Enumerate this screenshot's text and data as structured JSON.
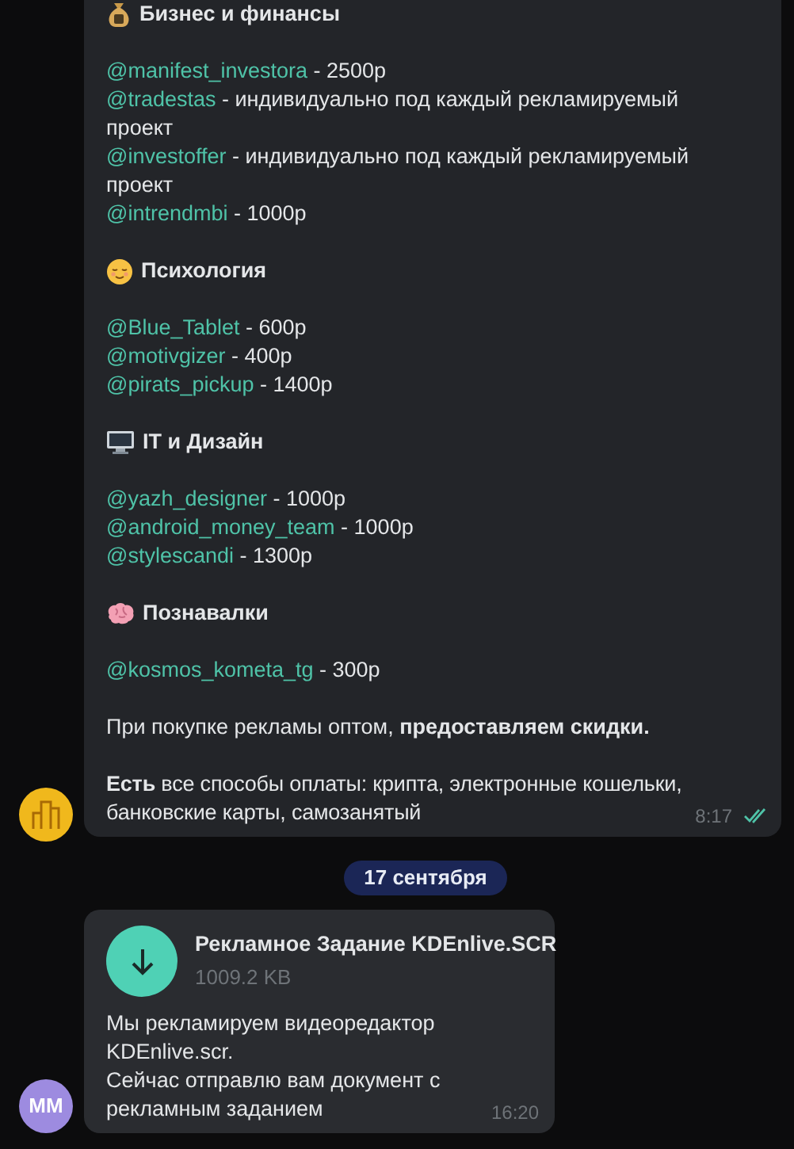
{
  "channel_post": {
    "avatar": {
      "kind": "buildings"
    },
    "sections": [
      {
        "kind": "money",
        "title": "Бизнес и финансы",
        "entries": [
          {
            "handle": "@manifest_investora",
            "text": " - 2500р"
          },
          {
            "handle": "@tradestas",
            "text": " - индивидуально под каждый рекламируемый проект"
          },
          {
            "handle": "@investoffer",
            "text": " - индивидуально под каждый рекламируемый проект"
          },
          {
            "handle": "@intrendmbi",
            "text": " - 1000р"
          }
        ]
      },
      {
        "kind": "relieved",
        "title": "Психология",
        "entries": [
          {
            "handle": "@Blue_Tablet",
            "text": " - 600р"
          },
          {
            "handle": "@motivgizer",
            "text": " - 400р"
          },
          {
            "handle": "@pirats_pickup",
            "text": " - 1400р"
          }
        ]
      },
      {
        "kind": "computer",
        "title": "IT и Дизайн",
        "entries": [
          {
            "handle": "@yazh_designer",
            "text": " - 1000р"
          },
          {
            "handle": "@android_money_team",
            "text": " - 1000р"
          },
          {
            "handle": "@stylescandi",
            "text": " - 1300р"
          }
        ]
      },
      {
        "kind": "brain",
        "title": "Познавалки",
        "entries": [
          {
            "handle": "@kosmos_kometa_tg",
            "text": " - 300р"
          }
        ]
      }
    ],
    "notes": [
      "При покупке рекламы оптом, **предоставляем скидки.**",
      "**Есть** все способы оплаты: крипта, электронные кошельки, банковские карты, самозанятый"
    ],
    "time": "8:17",
    "read": true
  },
  "date_separator": "17 сентября",
  "file_message": {
    "avatar": {
      "initials": "MM"
    },
    "file_name": "Рекламное Задание KDEnlive.SCR",
    "file_size": "1009.2 KB",
    "paragraphs": [
      "Мы рекламируем видеоредактор KDEnlive.scr.",
      "Сейчас отправлю вам документ с рекламным заданием"
    ],
    "time": "16:20"
  }
}
